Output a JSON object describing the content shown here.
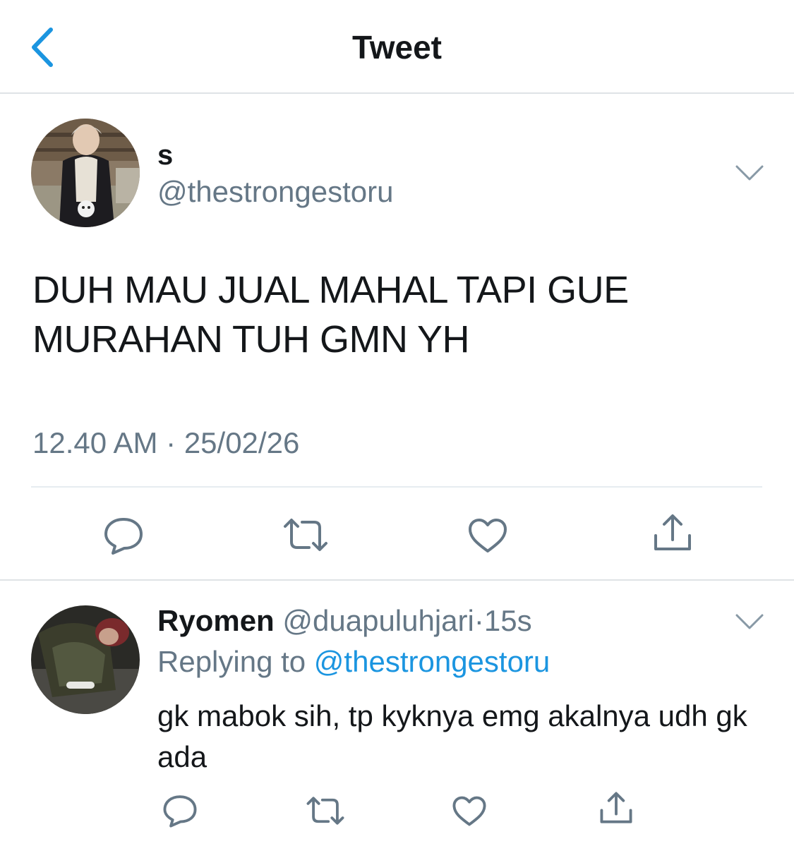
{
  "header": {
    "title": "Tweet",
    "back_icon": "chevron-left-icon"
  },
  "tweet": {
    "author": {
      "display_name": "s",
      "handle": "@thestrongestoru"
    },
    "text": "DUH MAU JUAL MAHAL TAPI GUE MURAHAN TUH GMN YH",
    "time": "12.40 AM",
    "separator": "·",
    "date": "25/02/26",
    "actions": [
      "reply-icon",
      "retweet-icon",
      "like-icon",
      "share-icon"
    ]
  },
  "reply": {
    "author": {
      "display_name": "Ryomen",
      "handle": "@duapuluhjari"
    },
    "separator": "·",
    "age": "15s",
    "replying_prefix": "Replying to",
    "replying_handle": "@thestrongestoru",
    "text": "gk mabok sih, tp kyknya emg akalnya udh gk ada",
    "actions": [
      "reply-icon",
      "retweet-icon",
      "like-icon",
      "share-icon"
    ]
  },
  "colors": {
    "accent": "#1b95e0",
    "icon": "#657786",
    "text": "#14171a",
    "divider": "#dfe3e6"
  }
}
